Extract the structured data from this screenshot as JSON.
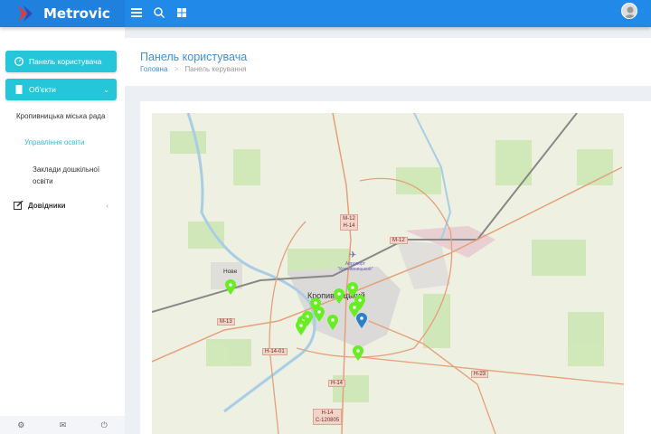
{
  "brand": {
    "name": "Metrovic"
  },
  "topbar": {
    "icons": [
      "menu-icon",
      "search-icon",
      "apps-grid-icon"
    ],
    "avatar": "user-avatar"
  },
  "sidebar": {
    "dashboard_label": "Панель користувача",
    "objects_label": "Об'єкти",
    "items": [
      "Кропивницька міська рада",
      "Управління освіти",
      "Заклади дошкільної освіти"
    ],
    "directories_label": "Довідники",
    "footer_icons": [
      "settings-icon",
      "mail-icon",
      "power-icon"
    ]
  },
  "page": {
    "title": "Панель користувача",
    "breadcrumb": {
      "home": "Головна",
      "separator": ">",
      "current": "Панель керування"
    }
  },
  "map": {
    "labels": {
      "city": "Кропивницький",
      "village": "Нове",
      "airport": "Аеропорт \"Кропивницький\"",
      "roads": [
        "М-12 Н-14",
        "М-12",
        "М-13",
        "Н-14-01",
        "Н-14",
        "Н-14 С-120805",
        "Н-23"
      ]
    },
    "marker_colors": {
      "green": "#66ee22",
      "blue": "#2a81cb"
    }
  },
  "colors": {
    "topbar": "#2189e8",
    "accent": "#26c6da",
    "title": "#3d8fdb"
  }
}
